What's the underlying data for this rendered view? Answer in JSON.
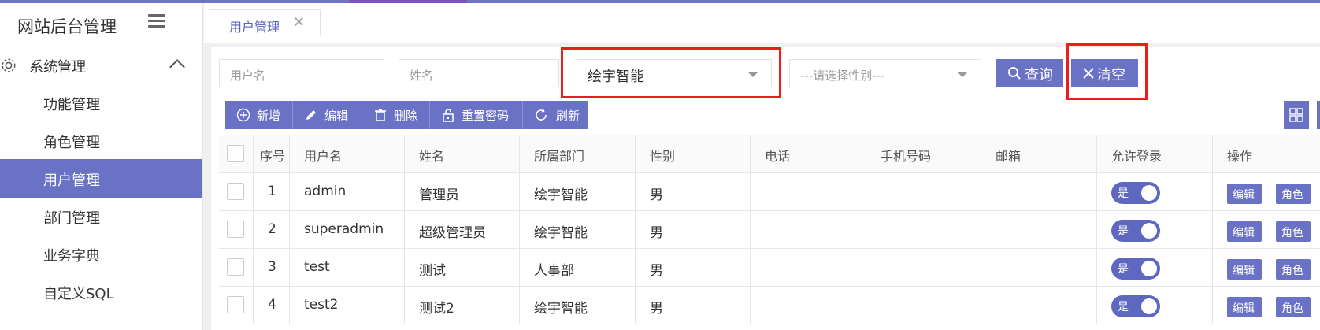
{
  "app": {
    "title": "网站后台管理"
  },
  "sidebar": {
    "group_label": "系统管理",
    "items": [
      {
        "label": "功能管理"
      },
      {
        "label": "角色管理"
      },
      {
        "label": "用户管理",
        "active": true
      },
      {
        "label": "部门管理"
      },
      {
        "label": "业务字典"
      },
      {
        "label": "自定义SQL"
      }
    ]
  },
  "tabs": [
    {
      "label": "用户管理",
      "close": "✕"
    }
  ],
  "search": {
    "username_placeholder": "用户名",
    "name_placeholder": "姓名",
    "department_value": "绘宇智能",
    "gender_placeholder": "---请选择性别---",
    "query_label": "查询",
    "clear_label": "清空"
  },
  "toolbar": {
    "add": "新增",
    "edit": "编辑",
    "delete": "删除",
    "reset_password": "重置密码",
    "refresh": "刷新"
  },
  "table": {
    "headers": [
      "序号",
      "用户名",
      "姓名",
      "所属部门",
      "性别",
      "电话",
      "手机号码",
      "邮箱",
      "允许登录",
      "操作"
    ],
    "rows": [
      {
        "no": "1",
        "username": "admin",
        "name": "管理员",
        "dept": "绘宇智能",
        "gender": "男",
        "phone": "",
        "mobile": "",
        "email": "",
        "login": "是",
        "op_edit": "编辑",
        "op_role": "角色"
      },
      {
        "no": "2",
        "username": "superadmin",
        "name": "超级管理员",
        "dept": "绘宇智能",
        "gender": "男",
        "phone": "",
        "mobile": "",
        "email": "",
        "login": "是",
        "op_edit": "编辑",
        "op_role": "角色"
      },
      {
        "no": "3",
        "username": "test",
        "name": "测试",
        "dept": "人事部",
        "gender": "男",
        "phone": "",
        "mobile": "",
        "email": "",
        "login": "是",
        "op_edit": "编辑",
        "op_role": "角色"
      },
      {
        "no": "4",
        "username": "test2",
        "name": "测试2",
        "dept": "绘宇智能",
        "gender": "男",
        "phone": "",
        "mobile": "",
        "email": "",
        "login": "是",
        "op_edit": "编辑",
        "op_role": "角色"
      }
    ]
  },
  "colors": {
    "accent": "#6a72c6",
    "highlight": "#ee1c1c"
  },
  "icons": [
    "menu-icon",
    "gear-icon",
    "chevron-up-icon",
    "close-icon",
    "search-icon",
    "plus-circle-icon",
    "pencil-icon",
    "trash-icon",
    "lock-icon",
    "refresh-icon",
    "columns-icon"
  ]
}
